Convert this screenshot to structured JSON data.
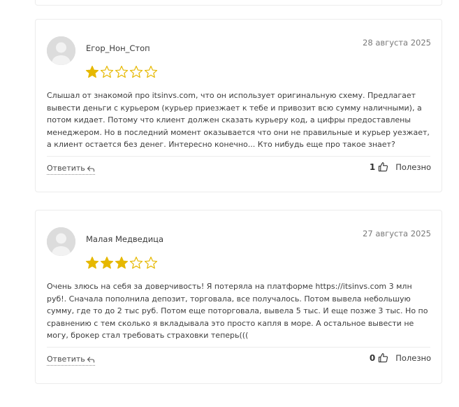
{
  "reviews": [
    {
      "author": "Егор_Нон_Стоп",
      "date": "28 августа 2025",
      "rating": 1,
      "max_rating": 5,
      "text": "Слышал от знакомой про itsinvs.com, что он использует оригинальную схему. Предлагает вывести деньги с курьером (курьер приезжает к тебе и привозит всю сумму наличными), а потом кидает. Потому что клиент должен сказать курьеру код, а цифры предоставлены менеджером. Но в последний момент оказывается что они не правильные и курьер уезжает, а клиент остается без денег. Интересно конечно... Кто нибудь еще про такое знает?",
      "reply_label": "Ответить",
      "likes": "1",
      "helpful_label": "Полезно"
    },
    {
      "author": "Малая Медведица",
      "date": "27 августа 2025",
      "rating": 3,
      "max_rating": 5,
      "text": "Очень злюсь на себя за доверчивость! Я потеряла на платформе https://itsinvs.com 3 млн руб!. Сначала пополнила депозит, торговала, все получалось. Потом вывела небольшую сумму, где то до 2 тыс руб. Потом еще поторговала, вывела 5 тыс. И еще позже 3 тыс. Но по сравнению с тем сколько я вкладывала это просто капля в море. А остальное вывести не могу, брокер стал требовать страховки теперь(((",
      "reply_label": "Ответить",
      "likes": "0",
      "helpful_label": "Полезно"
    }
  ],
  "colors": {
    "star_filled": "#e6b800",
    "star_outline": "#e6b800",
    "border": "#ececec",
    "text": "#3d3d3d",
    "date": "#7a7a7a"
  },
  "icons": {
    "avatar": "user-avatar-placeholder",
    "reply": "reply-arrow-icon",
    "like": "thumbs-up-icon",
    "star": "star-icon"
  }
}
